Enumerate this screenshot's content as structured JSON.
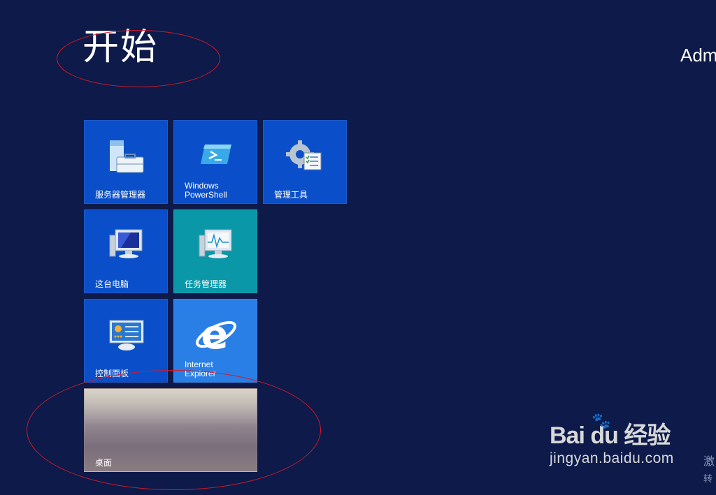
{
  "start": {
    "title": "开始"
  },
  "user": {
    "name": "Adm"
  },
  "tiles": [
    {
      "label": "服务器管理器",
      "icon": "server-manager-icon"
    },
    {
      "label": "Windows\nPowerShell",
      "icon": "powershell-icon"
    },
    {
      "label": "管理工具",
      "icon": "admin-tools-icon"
    },
    {
      "label": "这台电脑",
      "icon": "this-pc-icon"
    },
    {
      "label": "任务管理器",
      "icon": "task-manager-icon"
    },
    {
      "label": "控制面板",
      "icon": "control-panel-icon"
    },
    {
      "label": "Internet\nExplorer",
      "icon": "internet-explorer-icon"
    },
    {
      "label": "桌面",
      "icon": "desktop-wallpaper"
    }
  ],
  "watermark": {
    "brand": "Bai du 经验",
    "url": "jingyan.baidu.com"
  },
  "activation": {
    "line1": "激",
    "line2": "转"
  },
  "colors": {
    "background": "#0d1a4a",
    "tile": "#0a4fc9",
    "tile_teal": "#0a97a8",
    "tile_ie": "#2a7fe6",
    "annotation": "#d01a2a"
  }
}
